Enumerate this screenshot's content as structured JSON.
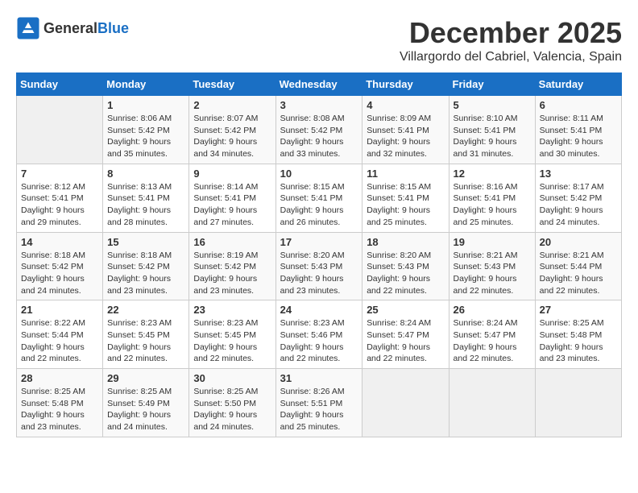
{
  "header": {
    "logo_general": "General",
    "logo_blue": "Blue",
    "month": "December 2025",
    "location": "Villargordo del Cabriel, Valencia, Spain"
  },
  "columns": [
    "Sunday",
    "Monday",
    "Tuesday",
    "Wednesday",
    "Thursday",
    "Friday",
    "Saturday"
  ],
  "weeks": [
    [
      {
        "day": "",
        "sunrise": "",
        "sunset": "",
        "daylight": ""
      },
      {
        "day": "1",
        "sunrise": "Sunrise: 8:06 AM",
        "sunset": "Sunset: 5:42 PM",
        "daylight": "Daylight: 9 hours and 35 minutes."
      },
      {
        "day": "2",
        "sunrise": "Sunrise: 8:07 AM",
        "sunset": "Sunset: 5:42 PM",
        "daylight": "Daylight: 9 hours and 34 minutes."
      },
      {
        "day": "3",
        "sunrise": "Sunrise: 8:08 AM",
        "sunset": "Sunset: 5:42 PM",
        "daylight": "Daylight: 9 hours and 33 minutes."
      },
      {
        "day": "4",
        "sunrise": "Sunrise: 8:09 AM",
        "sunset": "Sunset: 5:41 PM",
        "daylight": "Daylight: 9 hours and 32 minutes."
      },
      {
        "day": "5",
        "sunrise": "Sunrise: 8:10 AM",
        "sunset": "Sunset: 5:41 PM",
        "daylight": "Daylight: 9 hours and 31 minutes."
      },
      {
        "day": "6",
        "sunrise": "Sunrise: 8:11 AM",
        "sunset": "Sunset: 5:41 PM",
        "daylight": "Daylight: 9 hours and 30 minutes."
      }
    ],
    [
      {
        "day": "7",
        "sunrise": "Sunrise: 8:12 AM",
        "sunset": "Sunset: 5:41 PM",
        "daylight": "Daylight: 9 hours and 29 minutes."
      },
      {
        "day": "8",
        "sunrise": "Sunrise: 8:13 AM",
        "sunset": "Sunset: 5:41 PM",
        "daylight": "Daylight: 9 hours and 28 minutes."
      },
      {
        "day": "9",
        "sunrise": "Sunrise: 8:14 AM",
        "sunset": "Sunset: 5:41 PM",
        "daylight": "Daylight: 9 hours and 27 minutes."
      },
      {
        "day": "10",
        "sunrise": "Sunrise: 8:15 AM",
        "sunset": "Sunset: 5:41 PM",
        "daylight": "Daylight: 9 hours and 26 minutes."
      },
      {
        "day": "11",
        "sunrise": "Sunrise: 8:15 AM",
        "sunset": "Sunset: 5:41 PM",
        "daylight": "Daylight: 9 hours and 25 minutes."
      },
      {
        "day": "12",
        "sunrise": "Sunrise: 8:16 AM",
        "sunset": "Sunset: 5:41 PM",
        "daylight": "Daylight: 9 hours and 25 minutes."
      },
      {
        "day": "13",
        "sunrise": "Sunrise: 8:17 AM",
        "sunset": "Sunset: 5:42 PM",
        "daylight": "Daylight: 9 hours and 24 minutes."
      }
    ],
    [
      {
        "day": "14",
        "sunrise": "Sunrise: 8:18 AM",
        "sunset": "Sunset: 5:42 PM",
        "daylight": "Daylight: 9 hours and 24 minutes."
      },
      {
        "day": "15",
        "sunrise": "Sunrise: 8:18 AM",
        "sunset": "Sunset: 5:42 PM",
        "daylight": "Daylight: 9 hours and 23 minutes."
      },
      {
        "day": "16",
        "sunrise": "Sunrise: 8:19 AM",
        "sunset": "Sunset: 5:42 PM",
        "daylight": "Daylight: 9 hours and 23 minutes."
      },
      {
        "day": "17",
        "sunrise": "Sunrise: 8:20 AM",
        "sunset": "Sunset: 5:43 PM",
        "daylight": "Daylight: 9 hours and 23 minutes."
      },
      {
        "day": "18",
        "sunrise": "Sunrise: 8:20 AM",
        "sunset": "Sunset: 5:43 PM",
        "daylight": "Daylight: 9 hours and 22 minutes."
      },
      {
        "day": "19",
        "sunrise": "Sunrise: 8:21 AM",
        "sunset": "Sunset: 5:43 PM",
        "daylight": "Daylight: 9 hours and 22 minutes."
      },
      {
        "day": "20",
        "sunrise": "Sunrise: 8:21 AM",
        "sunset": "Sunset: 5:44 PM",
        "daylight": "Daylight: 9 hours and 22 minutes."
      }
    ],
    [
      {
        "day": "21",
        "sunrise": "Sunrise: 8:22 AM",
        "sunset": "Sunset: 5:44 PM",
        "daylight": "Daylight: 9 hours and 22 minutes."
      },
      {
        "day": "22",
        "sunrise": "Sunrise: 8:23 AM",
        "sunset": "Sunset: 5:45 PM",
        "daylight": "Daylight: 9 hours and 22 minutes."
      },
      {
        "day": "23",
        "sunrise": "Sunrise: 8:23 AM",
        "sunset": "Sunset: 5:45 PM",
        "daylight": "Daylight: 9 hours and 22 minutes."
      },
      {
        "day": "24",
        "sunrise": "Sunrise: 8:23 AM",
        "sunset": "Sunset: 5:46 PM",
        "daylight": "Daylight: 9 hours and 22 minutes."
      },
      {
        "day": "25",
        "sunrise": "Sunrise: 8:24 AM",
        "sunset": "Sunset: 5:47 PM",
        "daylight": "Daylight: 9 hours and 22 minutes."
      },
      {
        "day": "26",
        "sunrise": "Sunrise: 8:24 AM",
        "sunset": "Sunset: 5:47 PM",
        "daylight": "Daylight: 9 hours and 22 minutes."
      },
      {
        "day": "27",
        "sunrise": "Sunrise: 8:25 AM",
        "sunset": "Sunset: 5:48 PM",
        "daylight": "Daylight: 9 hours and 23 minutes."
      }
    ],
    [
      {
        "day": "28",
        "sunrise": "Sunrise: 8:25 AM",
        "sunset": "Sunset: 5:48 PM",
        "daylight": "Daylight: 9 hours and 23 minutes."
      },
      {
        "day": "29",
        "sunrise": "Sunrise: 8:25 AM",
        "sunset": "Sunset: 5:49 PM",
        "daylight": "Daylight: 9 hours and 24 minutes."
      },
      {
        "day": "30",
        "sunrise": "Sunrise: 8:25 AM",
        "sunset": "Sunset: 5:50 PM",
        "daylight": "Daylight: 9 hours and 24 minutes."
      },
      {
        "day": "31",
        "sunrise": "Sunrise: 8:26 AM",
        "sunset": "Sunset: 5:51 PM",
        "daylight": "Daylight: 9 hours and 25 minutes."
      },
      {
        "day": "",
        "sunrise": "",
        "sunset": "",
        "daylight": ""
      },
      {
        "day": "",
        "sunrise": "",
        "sunset": "",
        "daylight": ""
      },
      {
        "day": "",
        "sunrise": "",
        "sunset": "",
        "daylight": ""
      }
    ]
  ]
}
